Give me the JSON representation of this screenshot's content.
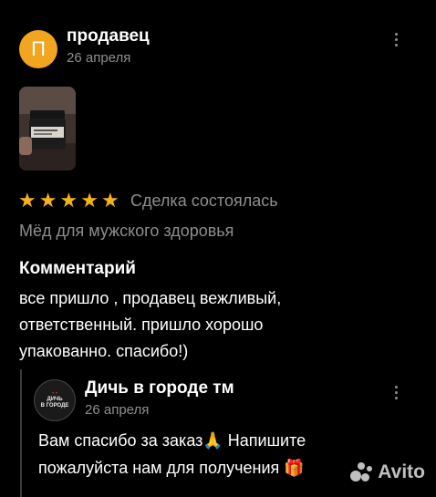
{
  "review": {
    "avatar_letter": "П",
    "author": "продавец",
    "date": "26 апреля",
    "rating_stars": 5,
    "star_glyph": "★",
    "deal_status": "Сделка состоялась",
    "product": "Мёд для мужского здоровья",
    "comment_title": "Комментарий",
    "comment_lines": [
      "все пришло , продавец вежливый,",
      "ответственный. пришло хорошо",
      "упакованно. спасибо!)"
    ]
  },
  "reply": {
    "shop_logo_text_1": "ДИЧЬ",
    "shop_logo_text_2": "В ГОРОДЕ",
    "shop_name": "Дичь в городе тм",
    "date": "26 апреля",
    "lines": [
      "Вам спасибо за заказ🙏 Напишите",
      "пожалуйста нам для получения 🎁"
    ]
  },
  "watermark": {
    "text": "Avito"
  },
  "colors": {
    "background": "#000000",
    "avatar": "#f2a51f",
    "stars": "#f6b318",
    "muted_text": "#8e8e8e"
  },
  "icons": {
    "menu": "kebab-menu-icon",
    "star": "star-icon"
  }
}
